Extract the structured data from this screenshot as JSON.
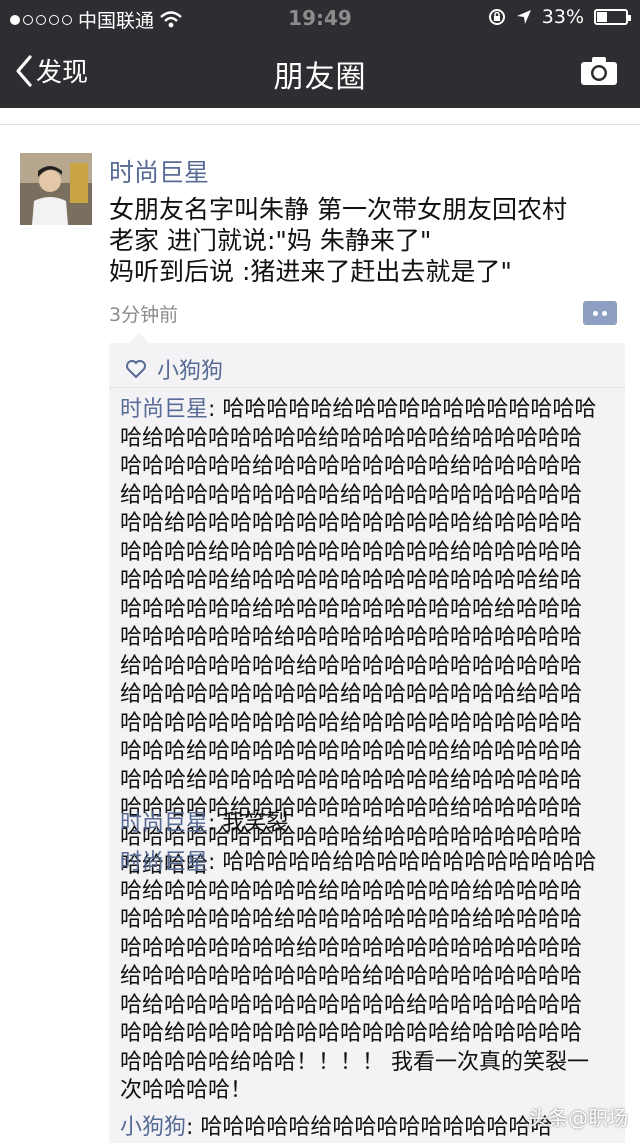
{
  "status_bar": {
    "carrier": "中国联通",
    "time": "19:49",
    "battery": "33%"
  },
  "nav": {
    "back_label": "发现",
    "title": "朋友圈"
  },
  "post": {
    "author": "时尚巨星",
    "content_lines": [
      "女朋友名字叫朱静 第一次带女朋友回农村",
      "老家 进门就说:\"妈 朱静来了\"",
      "妈听到后说 :猪进来了赶出去就是了\""
    ],
    "time_ago": "3分钟前"
  },
  "likes": {
    "names": "小狗狗"
  },
  "comments": [
    {
      "name": "时尚巨星",
      "text": ": 哈哈哈哈哈给哈哈哈哈哈哈哈哈哈哈哈哈给哈哈哈哈哈哈哈给哈哈哈哈哈给哈哈哈哈哈哈哈哈哈哈哈给哈哈哈哈哈哈哈哈给哈哈哈哈哈给哈哈哈哈哈哈哈哈哈给哈哈哈哈哈哈哈哈哈哈哈哈给哈哈哈哈哈哈哈哈哈哈哈哈哈给哈哈哈哈哈哈哈哈给哈哈哈哈哈哈哈哈哈哈给哈哈哈哈哈哈哈哈哈哈给哈哈哈哈哈哈哈哈哈哈哈哈哈给哈哈哈哈哈哈哈给哈哈哈哈哈哈哈哈哈哈给哈哈哈哈哈哈哈哈哈哈给哈哈哈哈哈哈哈哈哈哈哈哈哈给哈哈哈哈哈哈哈给哈哈哈哈哈哈哈哈哈哈哈哈给哈哈哈哈哈哈哈哈哈给哈哈哈哈哈哈哈给哈哈哈哈哈哈哈哈哈哈哈哈给哈哈哈哈哈哈哈哈哈哈哈哈哈给哈哈哈哈哈哈哈哈哈哈哈给哈哈哈哈哈哈哈哈给哈哈哈哈哈哈哈哈哈哈哈给哈哈哈哈哈哈哈哈哈哈给哈哈哈哈哈哈哈哈哈给哈哈哈哈哈哈哈哈哈哈哈哈哈哈哈哈给哈哈哈哈哈哈哈哈哈哈给哈哈"
    },
    {
      "name": "时尚巨星",
      "text": ": 我笑裂"
    },
    {
      "name": "时尚巨星",
      "text": ": 哈哈哈哈哈给哈哈哈哈哈哈哈哈哈哈哈哈给哈哈哈哈哈哈哈给哈哈哈哈哈哈给哈哈哈哈哈哈哈哈哈哈哈给哈哈哈哈哈哈哈哈给哈哈哈哈哈哈哈哈哈哈哈哈给哈哈哈哈哈哈哈哈哈哈哈哈给哈哈哈哈哈哈哈哈哈哈给哈哈哈哈哈哈哈哈哈哈给哈哈哈哈哈哈哈哈哈哈哈给哈哈哈哈哈哈哈哈哈给哈哈哈哈哈哈哈哈哈哈哈哈给哈哈哈哈哈哈哈哈哈哈给哈哈！！！！ 我看一次真的笑裂一次哈哈哈哈！"
    },
    {
      "name": "小狗狗",
      "text": ": 哈哈哈哈哈给哈哈哈哈哈哈哈哈哈哈"
    }
  ],
  "watermark": "头条@职场"
}
